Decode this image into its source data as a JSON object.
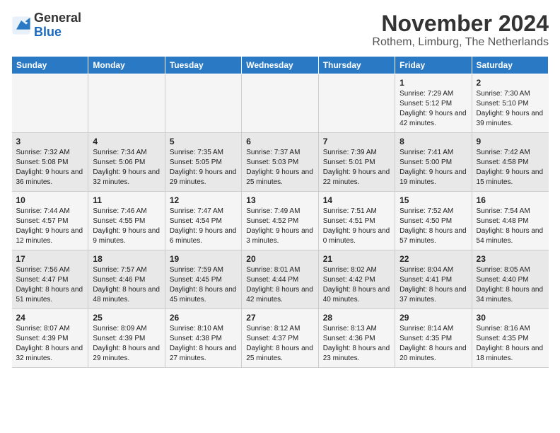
{
  "logo": {
    "general": "General",
    "blue": "Blue"
  },
  "title": "November 2024",
  "subtitle": "Rothem, Limburg, The Netherlands",
  "days_of_week": [
    "Sunday",
    "Monday",
    "Tuesday",
    "Wednesday",
    "Thursday",
    "Friday",
    "Saturday"
  ],
  "weeks": [
    [
      {
        "day": "",
        "content": ""
      },
      {
        "day": "",
        "content": ""
      },
      {
        "day": "",
        "content": ""
      },
      {
        "day": "",
        "content": ""
      },
      {
        "day": "",
        "content": ""
      },
      {
        "day": "1",
        "content": "Sunrise: 7:29 AM\nSunset: 5:12 PM\nDaylight: 9 hours and 42 minutes."
      },
      {
        "day": "2",
        "content": "Sunrise: 7:30 AM\nSunset: 5:10 PM\nDaylight: 9 hours and 39 minutes."
      }
    ],
    [
      {
        "day": "3",
        "content": "Sunrise: 7:32 AM\nSunset: 5:08 PM\nDaylight: 9 hours and 36 minutes."
      },
      {
        "day": "4",
        "content": "Sunrise: 7:34 AM\nSunset: 5:06 PM\nDaylight: 9 hours and 32 minutes."
      },
      {
        "day": "5",
        "content": "Sunrise: 7:35 AM\nSunset: 5:05 PM\nDaylight: 9 hours and 29 minutes."
      },
      {
        "day": "6",
        "content": "Sunrise: 7:37 AM\nSunset: 5:03 PM\nDaylight: 9 hours and 25 minutes."
      },
      {
        "day": "7",
        "content": "Sunrise: 7:39 AM\nSunset: 5:01 PM\nDaylight: 9 hours and 22 minutes."
      },
      {
        "day": "8",
        "content": "Sunrise: 7:41 AM\nSunset: 5:00 PM\nDaylight: 9 hours and 19 minutes."
      },
      {
        "day": "9",
        "content": "Sunrise: 7:42 AM\nSunset: 4:58 PM\nDaylight: 9 hours and 15 minutes."
      }
    ],
    [
      {
        "day": "10",
        "content": "Sunrise: 7:44 AM\nSunset: 4:57 PM\nDaylight: 9 hours and 12 minutes."
      },
      {
        "day": "11",
        "content": "Sunrise: 7:46 AM\nSunset: 4:55 PM\nDaylight: 9 hours and 9 minutes."
      },
      {
        "day": "12",
        "content": "Sunrise: 7:47 AM\nSunset: 4:54 PM\nDaylight: 9 hours and 6 minutes."
      },
      {
        "day": "13",
        "content": "Sunrise: 7:49 AM\nSunset: 4:52 PM\nDaylight: 9 hours and 3 minutes."
      },
      {
        "day": "14",
        "content": "Sunrise: 7:51 AM\nSunset: 4:51 PM\nDaylight: 9 hours and 0 minutes."
      },
      {
        "day": "15",
        "content": "Sunrise: 7:52 AM\nSunset: 4:50 PM\nDaylight: 8 hours and 57 minutes."
      },
      {
        "day": "16",
        "content": "Sunrise: 7:54 AM\nSunset: 4:48 PM\nDaylight: 8 hours and 54 minutes."
      }
    ],
    [
      {
        "day": "17",
        "content": "Sunrise: 7:56 AM\nSunset: 4:47 PM\nDaylight: 8 hours and 51 minutes."
      },
      {
        "day": "18",
        "content": "Sunrise: 7:57 AM\nSunset: 4:46 PM\nDaylight: 8 hours and 48 minutes."
      },
      {
        "day": "19",
        "content": "Sunrise: 7:59 AM\nSunset: 4:45 PM\nDaylight: 8 hours and 45 minutes."
      },
      {
        "day": "20",
        "content": "Sunrise: 8:01 AM\nSunset: 4:44 PM\nDaylight: 8 hours and 42 minutes."
      },
      {
        "day": "21",
        "content": "Sunrise: 8:02 AM\nSunset: 4:42 PM\nDaylight: 8 hours and 40 minutes."
      },
      {
        "day": "22",
        "content": "Sunrise: 8:04 AM\nSunset: 4:41 PM\nDaylight: 8 hours and 37 minutes."
      },
      {
        "day": "23",
        "content": "Sunrise: 8:05 AM\nSunset: 4:40 PM\nDaylight: 8 hours and 34 minutes."
      }
    ],
    [
      {
        "day": "24",
        "content": "Sunrise: 8:07 AM\nSunset: 4:39 PM\nDaylight: 8 hours and 32 minutes."
      },
      {
        "day": "25",
        "content": "Sunrise: 8:09 AM\nSunset: 4:39 PM\nDaylight: 8 hours and 29 minutes."
      },
      {
        "day": "26",
        "content": "Sunrise: 8:10 AM\nSunset: 4:38 PM\nDaylight: 8 hours and 27 minutes."
      },
      {
        "day": "27",
        "content": "Sunrise: 8:12 AM\nSunset: 4:37 PM\nDaylight: 8 hours and 25 minutes."
      },
      {
        "day": "28",
        "content": "Sunrise: 8:13 AM\nSunset: 4:36 PM\nDaylight: 8 hours and 23 minutes."
      },
      {
        "day": "29",
        "content": "Sunrise: 8:14 AM\nSunset: 4:35 PM\nDaylight: 8 hours and 20 minutes."
      },
      {
        "day": "30",
        "content": "Sunrise: 8:16 AM\nSunset: 4:35 PM\nDaylight: 8 hours and 18 minutes."
      }
    ]
  ]
}
